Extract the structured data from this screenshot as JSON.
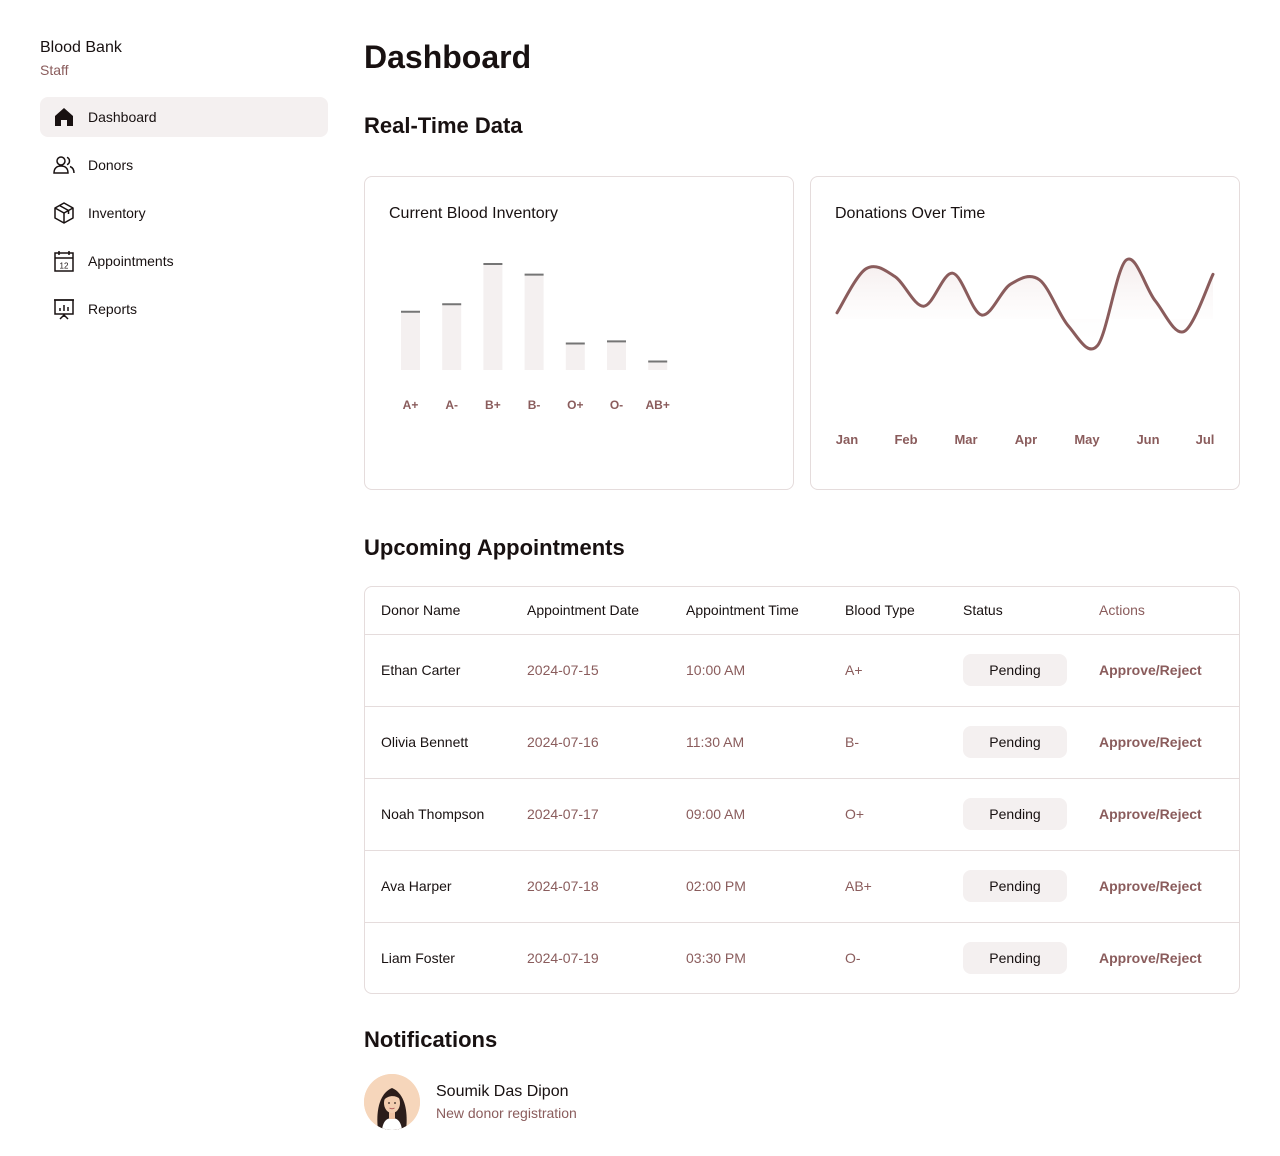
{
  "sidebar": {
    "title": "Blood Bank",
    "subtitle": "Staff",
    "items": [
      {
        "label": "Dashboard",
        "icon": "home-icon",
        "active": true
      },
      {
        "label": "Donors",
        "icon": "users-icon"
      },
      {
        "label": "Inventory",
        "icon": "package-icon"
      },
      {
        "label": "Appointments",
        "icon": "calendar-icon"
      },
      {
        "label": "Reports",
        "icon": "presentation-chart-icon"
      }
    ]
  },
  "main": {
    "page_title": "Dashboard",
    "realtime_title": "Real-Time Data",
    "appointments_title": "Upcoming Appointments",
    "notifications_title": "Notifications"
  },
  "chart_data": [
    {
      "type": "bar",
      "title": "Current Blood Inventory",
      "categories": [
        "A+",
        "A-",
        "B+",
        "B-",
        "O+",
        "O-",
        "AB+"
      ],
      "values": [
        55,
        62,
        100,
        90,
        25,
        27,
        8
      ],
      "ylim": [
        0,
        100
      ],
      "grid": false,
      "colors": {
        "fill": "#f4f0f0",
        "top_line": "#757575",
        "label": "#8a5c5c"
      }
    },
    {
      "type": "line",
      "title": "Donations Over Time",
      "categories": [
        "Jan",
        "Feb",
        "Mar",
        "Apr",
        "May",
        "Jun",
        "Jul"
      ],
      "values": [
        52,
        92,
        85,
        58,
        88,
        50,
        78,
        82,
        40,
        22,
        100,
        63,
        35,
        87
      ],
      "ylim": [
        0,
        110
      ],
      "grid": false,
      "colors": {
        "line": "#8a5c5c",
        "label": "#8a5c5c"
      }
    }
  ],
  "table": {
    "columns": [
      "Donor Name",
      "Appointment Date",
      "Appointment Time",
      "Blood Type",
      "Status",
      "Actions"
    ],
    "rows": [
      {
        "name": "Ethan Carter",
        "date": "2024-07-15",
        "time": "10:00 AM",
        "blood": "A+",
        "status": "Pending",
        "action": "Approve/Reject"
      },
      {
        "name": "Olivia Bennett",
        "date": "2024-07-16",
        "time": "11:30 AM",
        "blood": "B-",
        "status": "Pending",
        "action": "Approve/Reject"
      },
      {
        "name": "Noah Thompson",
        "date": "2024-07-17",
        "time": "09:00 AM",
        "blood": "O+",
        "status": "Pending",
        "action": "Approve/Reject"
      },
      {
        "name": "Ava Harper",
        "date": "2024-07-18",
        "time": "02:00 PM",
        "blood": "AB+",
        "status": "Pending",
        "action": "Approve/Reject"
      },
      {
        "name": "Liam Foster",
        "date": "2024-07-19",
        "time": "03:30 PM",
        "blood": "O-",
        "status": "Pending",
        "action": "Approve/Reject"
      }
    ]
  },
  "notifications": [
    {
      "name": "Soumik Das Dipon",
      "message": "New donor registration",
      "avatar": "avatar-woman"
    }
  ],
  "colors": {
    "accent": "#8a5c5c",
    "surface": "#f4f0f0",
    "border": "#e5dcdc",
    "text": "#181111"
  }
}
